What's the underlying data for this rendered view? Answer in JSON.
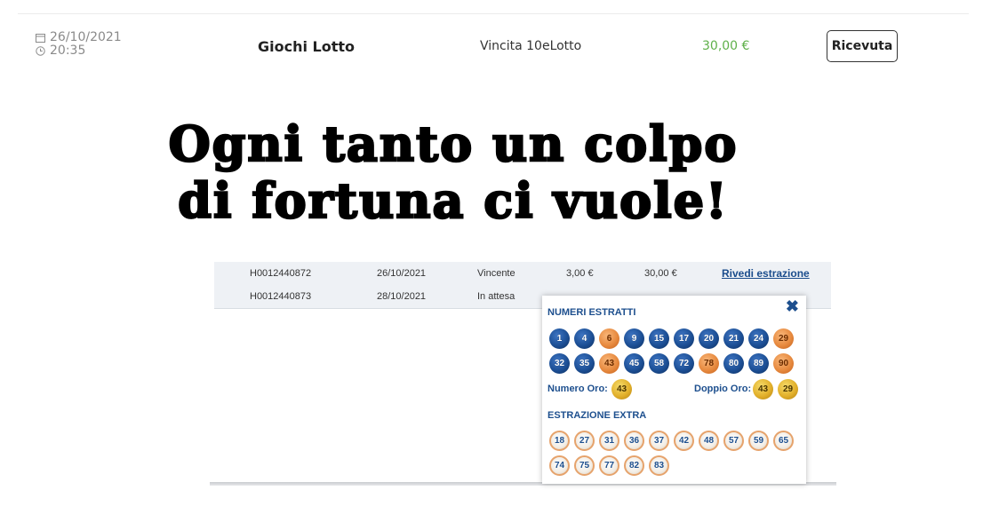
{
  "header": {
    "date": "26/10/2021",
    "time": "20:35",
    "game": "Giochi Lotto",
    "description": "Vincita 10eLotto",
    "amount": "30,00 €",
    "receipt_label": "Ricevuta"
  },
  "headline": {
    "line1": "Ogni tanto un colpo",
    "line2": "di fortuna ci vuole!"
  },
  "table": {
    "rows": [
      {
        "id": "H0012440872",
        "date": "26/10/2021",
        "status": "Vincente",
        "stake": "3,00 €",
        "win": "30,00 €",
        "action": "Rivedi estrazione"
      },
      {
        "id": "H0012440873",
        "date": "28/10/2021",
        "status": "In attesa"
      }
    ]
  },
  "popup": {
    "close_icon": "close-x-icon",
    "numeri_title": "NUMERI ESTRATTI",
    "numeri": [
      "1",
      "4",
      "6",
      "9",
      "15",
      "17",
      "20",
      "21",
      "24",
      "29",
      "32",
      "35",
      "43",
      "45",
      "58",
      "72",
      "78",
      "80",
      "89",
      "90"
    ],
    "numeri_colors": [
      "blue",
      "blue",
      "orange",
      "blue",
      "blue",
      "blue",
      "blue",
      "blue",
      "blue",
      "orange",
      "blue",
      "blue",
      "orange",
      "blue",
      "blue",
      "blue",
      "orange",
      "blue",
      "blue",
      "orange"
    ],
    "numero_oro_label": "Numero Oro:",
    "numero_oro": "43",
    "doppio_oro_label": "Doppio Oro:",
    "doppio_oro": [
      "43",
      "29"
    ],
    "extra_title": "ESTRAZIONE EXTRA",
    "extra": [
      "18",
      "27",
      "31",
      "36",
      "37",
      "42",
      "48",
      "57",
      "59",
      "65",
      "74",
      "75",
      "77",
      "82",
      "83"
    ]
  },
  "colors": {
    "brand_blue": "#1d4f8e",
    "amount_green": "#5fb04a"
  }
}
